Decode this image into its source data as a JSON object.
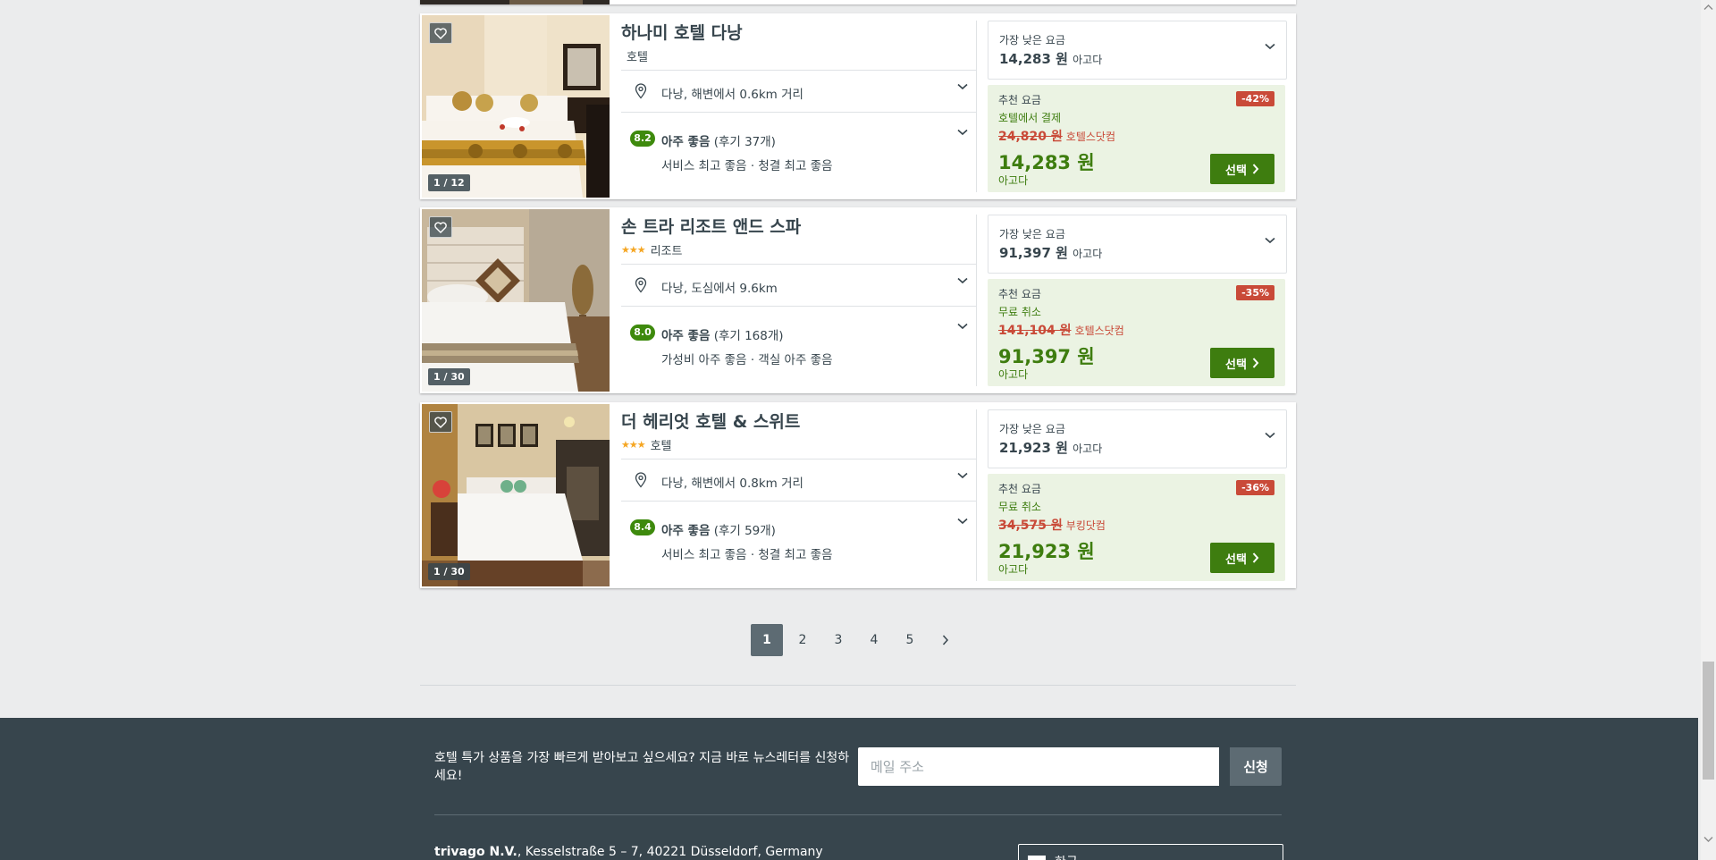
{
  "hotels": [
    {
      "name": "하나미 호텔 다낭",
      "stars": "",
      "type": "호텔",
      "location": "다낭, 해변에서 0.6km 거리",
      "rating_score": "8.2",
      "rating_label": "아주 좋음",
      "rating_reviews": "(후기 37개)",
      "rating_detail": "서비스 최고 좋음 · 청결 최고 좋음",
      "image_count": "1 / 12",
      "lowest_label": "가장 낮은 요금",
      "lowest_price": "14,283 원",
      "lowest_site": "아고다",
      "deal_label": "추천 요금",
      "discount": "-42%",
      "deal_condition": "호텔에서 결제",
      "old_price": "24,820 원",
      "old_site": "호텔스닷컴",
      "deal_price": "14,283 원",
      "deal_site": "아고다",
      "select_label": "선택"
    },
    {
      "name": "손 트라 리조트 앤드 스파",
      "stars": "★★★",
      "type": "리조트",
      "location": "다낭, 도심에서 9.6km",
      "rating_score": "8.0",
      "rating_label": "아주 좋음",
      "rating_reviews": "(후기 168개)",
      "rating_detail": "가성비 아주 좋음 · 객실 아주 좋음",
      "image_count": "1 / 30",
      "lowest_label": "가장 낮은 요금",
      "lowest_price": "91,397 원",
      "lowest_site": "아고다",
      "deal_label": "추천 요금",
      "discount": "-35%",
      "deal_condition": "무료 취소",
      "old_price": "141,104 원",
      "old_site": "호텔스닷컴",
      "deal_price": "91,397 원",
      "deal_site": "아고다",
      "select_label": "선택"
    },
    {
      "name": "더 헤리엇 호텔 & 스위트",
      "stars": "★★★",
      "type": "호텔",
      "location": "다낭, 해변에서 0.8km 거리",
      "rating_score": "8.4",
      "rating_label": "아주 좋음",
      "rating_reviews": "(후기 59개)",
      "rating_detail": "서비스 최고 좋음 · 청결 최고 좋음",
      "image_count": "1 / 30",
      "lowest_label": "가장 낮은 요금",
      "lowest_price": "21,923 원",
      "lowest_site": "아고다",
      "deal_label": "추천 요금",
      "discount": "-36%",
      "deal_condition": "무료 취소",
      "old_price": "34,575 원",
      "old_site": "부킹닷컴",
      "deal_price": "21,923 원",
      "deal_site": "아고다",
      "select_label": "선택"
    }
  ],
  "pagination": {
    "pages": [
      "1",
      "2",
      "3",
      "4",
      "5"
    ],
    "current": "1",
    "next_icon": "chevron-right-icon"
  },
  "footer": {
    "newsletter_text": "호텔 특가 상품을 가장 빠르게 받아보고 싶으세요? 지금 바로 뉴스레터를 신청하세요!",
    "email_placeholder": "메일 주소",
    "subscribe_label": "신청",
    "company_name": "trivago N.V.",
    "company_address": ", Kesselstraße 5 – 7, 40221 Düsseldorf, Germany",
    "language_label": "한국"
  },
  "colors": {
    "accent_green": "#3e7d0f",
    "discount_red": "#c94a38",
    "footer_bg": "#37454d",
    "rating_green": "#3e8a0d"
  }
}
